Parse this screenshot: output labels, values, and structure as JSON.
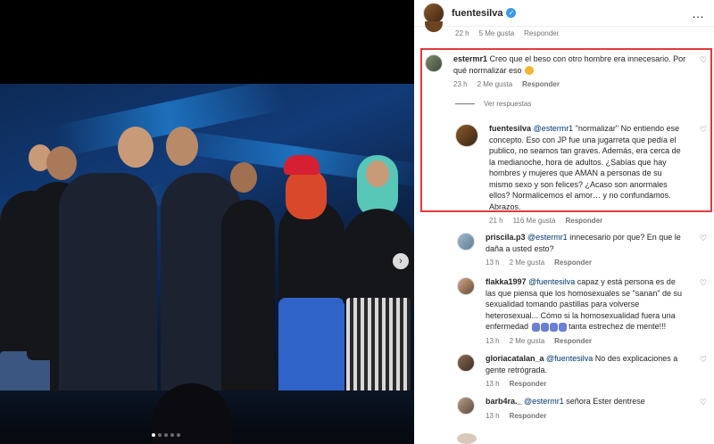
{
  "post": {
    "author": "fuentesilva",
    "more_icon": "…"
  },
  "previous_comment": {
    "time": "22 h",
    "likes": "5 Me gusta",
    "reply": "Responder"
  },
  "comments": [
    {
      "user": "estermr1",
      "text": "Creo que el beso con otro hombre era innecesario. Por qué normalizar eso",
      "time": "23 h",
      "likes": "2 Me gusta",
      "reply": "Responder"
    }
  ],
  "view_replies": "Ver respuestas",
  "reply": {
    "user": "fuentesilva",
    "mention": "@estermr1",
    "text": "\"normalizar\" No entiendo ese concepto. Eso con JP fue una jugarreta que pedía el publico, no seamos tan graves. Además, era cerca de la medianoche, hora de adultos. ¿Sabías que hay hombres y mujeres que AMAN a personas de su mismo sexo y son felices? ¿Acaso son anormales ellos? Normalicemos el amor… y no confundamos. Abrazos.",
    "time": "21 h",
    "likes": "116 Me gusta",
    "reply_label": "Responder"
  },
  "more_comments": [
    {
      "user": "priscila.p3",
      "mention": "@estermr1",
      "text": "innecesario por que? En que le daña a usted esto?",
      "time": "13 h",
      "likes": "2 Me gusta",
      "reply": "Responder"
    },
    {
      "user": "flakka1997",
      "mention": "@fuentesilva",
      "text": "capaz y está persona es de las que piensa que los homosexuales se \"sanan\" de su sexualidad tomando pastillas para volverse heterosexual... Cómo si la homosexualidad fuera una enfermedad",
      "text_tail": "tanta estrechez de mente!!!",
      "time": "13 h",
      "likes": "2 Me gusta",
      "reply": "Responder"
    },
    {
      "user": "gloriacatalan_a",
      "mention": "@fuentesilva",
      "text": "No des explicaciones a gente retrógrada.",
      "time": "13 h",
      "likes": "",
      "reply": "Responder"
    },
    {
      "user": "barb4ra._",
      "mention": "@estermr1",
      "text": "señora Ester dentrese",
      "time": "13 h",
      "likes": "",
      "reply": "Responder"
    }
  ],
  "colors": {
    "highlight": "#e23a3a",
    "verified": "#3897f0",
    "mention": "#00376b"
  }
}
